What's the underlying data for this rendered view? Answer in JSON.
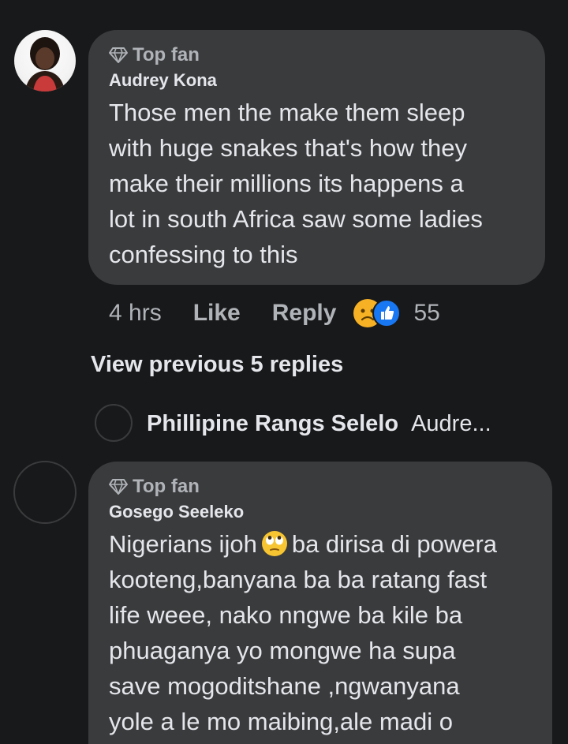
{
  "comments": [
    {
      "badge": "Top fan",
      "author": "Audrey Kona",
      "text": "Those men the make them sleep\nwith huge snakes that's how they\nmake their millions its happens a\nlot in south Africa saw some ladies\nconfessing to this",
      "time": "4 hrs",
      "like_label": "Like",
      "reply_label": "Reply",
      "reaction_count": "55",
      "reaction_icons": [
        "sad-reaction-icon",
        "like-reaction-icon"
      ]
    },
    {
      "badge": "Top fan",
      "author": "Gosego Seeleko",
      "text_part1": "Nigerians ijoh",
      "text_part2": "ba dirisa di powera\nkooteng,banyana ba ba ratang fast\nlife weee, nako nngwe ba kile ba\nphuaganya yo mongwe ha supa\nsave mogoditshane ,ngwanyana\nyole a le mo maibing,ale madi o",
      "emoji": "eye-roll-emoji-icon"
    }
  ],
  "thread": {
    "view_previous": "View previous 5 replies",
    "reply_author": "Phillipine Rangs Selelo",
    "reply_preview": "Audre..."
  },
  "colors": {
    "background": "#18191a",
    "bubble": "#3a3b3c",
    "text": "#e4e6eb",
    "secondary_text": "#b0b3b8",
    "like_blue": "#1877f2",
    "sad_yellow": "#f7b125"
  }
}
